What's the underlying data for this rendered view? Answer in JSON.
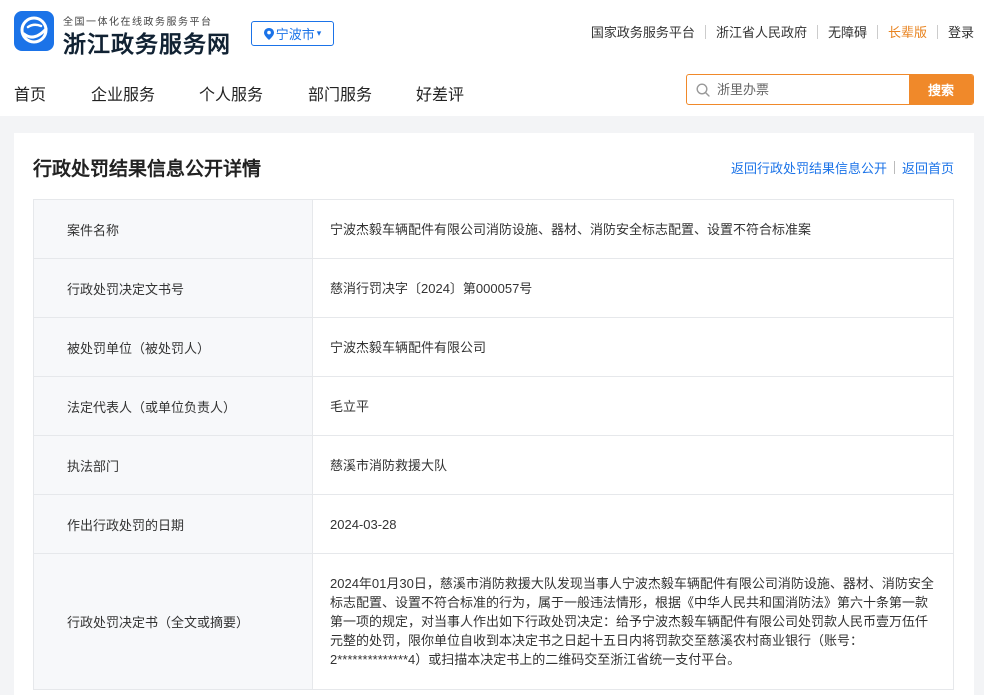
{
  "header": {
    "subtitle": "全国一体化在线政务服务平台",
    "title": "浙江政务服务网",
    "city": "宁波市",
    "city_caret": "▾",
    "links": [
      "国家政务服务平台",
      "浙江省人民政府",
      "无障碍",
      "长辈版",
      "登录"
    ]
  },
  "nav": {
    "items": [
      "首页",
      "企业服务",
      "个人服务",
      "部门服务",
      "好差评"
    ]
  },
  "search": {
    "placeholder": "浙里办票",
    "button": "搜索"
  },
  "detail": {
    "title": "行政处罚结果信息公开详情",
    "back_link": "返回行政处罚结果信息公开",
    "home_link": "返回首页",
    "rows": [
      {
        "key": "案件名称",
        "value": "宁波杰毅车辆配件有限公司消防设施、器材、消防安全标志配置、设置不符合标准案"
      },
      {
        "key": "行政处罚决定文书号",
        "value": "慈消行罚决字〔2024〕第000057号"
      },
      {
        "key": "被处罚单位（被处罚人）",
        "value": "宁波杰毅车辆配件有限公司"
      },
      {
        "key": "法定代表人（或单位负责人）",
        "value": "毛立平"
      },
      {
        "key": "执法部门",
        "value": "慈溪市消防救援大队"
      },
      {
        "key": "作出行政处罚的日期",
        "value": "2024-03-28"
      },
      {
        "key": "行政处罚决定书（全文或摘要）",
        "value": "2024年01月30日，慈溪市消防救援大队发现当事人宁波杰毅车辆配件有限公司消防设施、器材、消防安全标志配置、设置不符合标准的行为，属于一般违法情形，根据《中华人民共和国消防法》第六十条第一款第一项的规定，对当事人作出如下行政处罚决定：给予宁波杰毅车辆配件有限公司处罚款人民币壹万伍仟元整的处罚，限你单位自收到本决定书之日起十五日内将罚款交至慈溪农村商业银行（账号：2**************4）或扫描本决定书上的二维码交至浙江省统一支付平台。"
      }
    ]
  },
  "colors": {
    "brand_blue": "#1b73e8",
    "search_orange": "#f0892a",
    "elder_orange": "#e8831f"
  }
}
